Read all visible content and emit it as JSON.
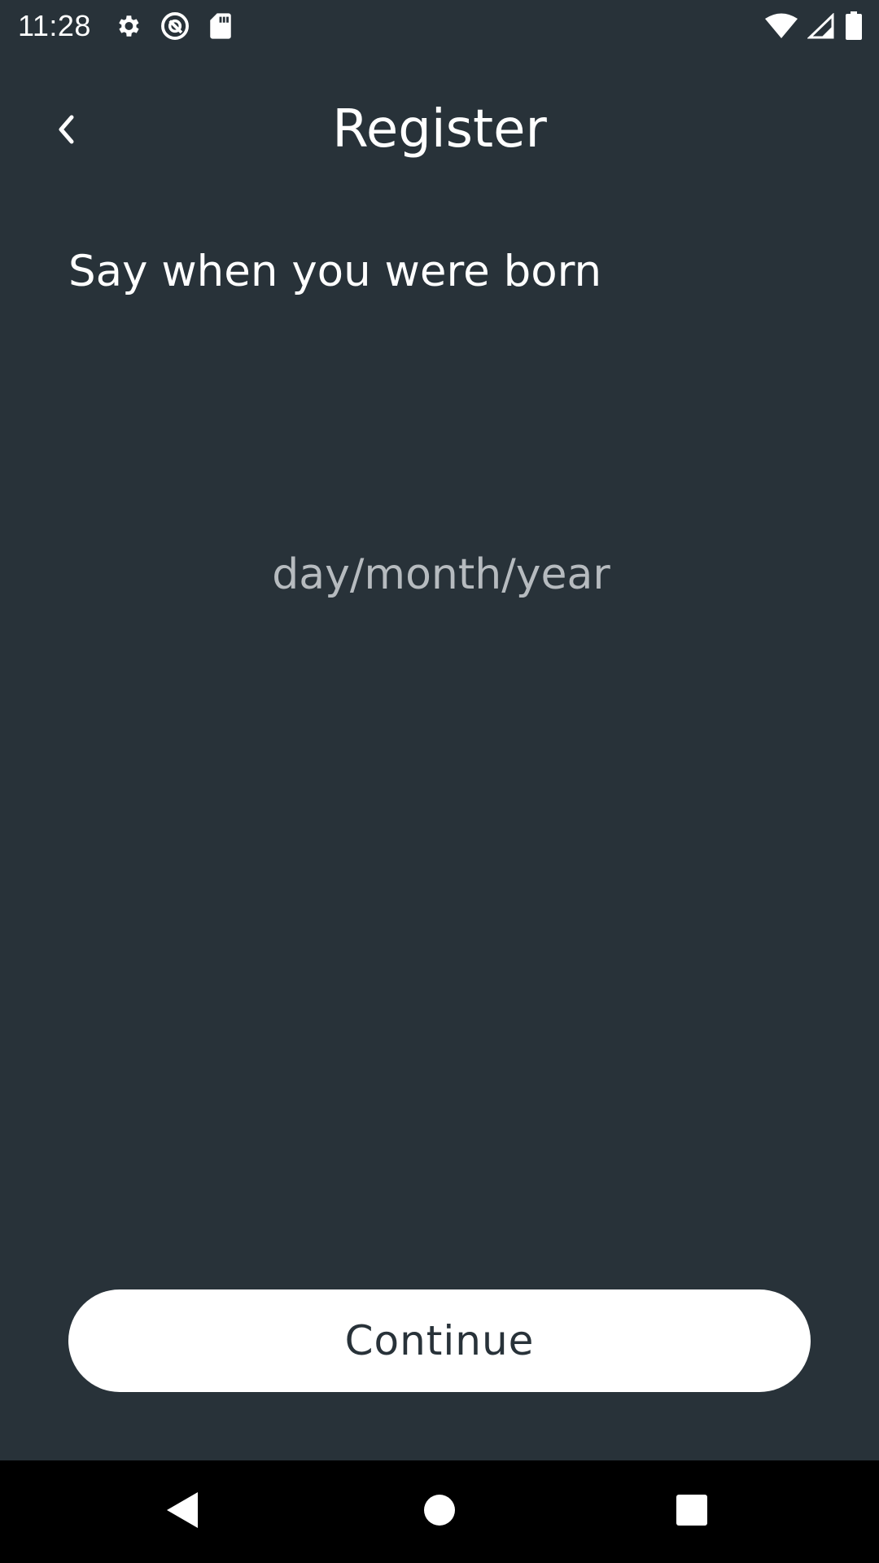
{
  "status_bar": {
    "time": "11:28",
    "left_icons": [
      "gear-icon",
      "do-not-disturb-icon",
      "sd-card-icon"
    ],
    "right_icons": [
      "wifi-icon",
      "cell-signal-icon",
      "battery-icon"
    ]
  },
  "header": {
    "title": "Register",
    "back_icon": "chevron-left-icon"
  },
  "form": {
    "prompt": "Say when you were born",
    "birthdate": {
      "value": "",
      "placeholder": "day/month/year"
    },
    "continue_label": "Continue"
  },
  "nav_bar": {
    "buttons": [
      "back-triangle-icon",
      "home-circle-icon",
      "recents-square-icon"
    ]
  },
  "colors": {
    "background": "#283239",
    "text": "#ffffff",
    "placeholder": "#b6bbbf",
    "button_bg": "#ffffff",
    "button_text": "#283239",
    "nav_bar": "#000000"
  }
}
